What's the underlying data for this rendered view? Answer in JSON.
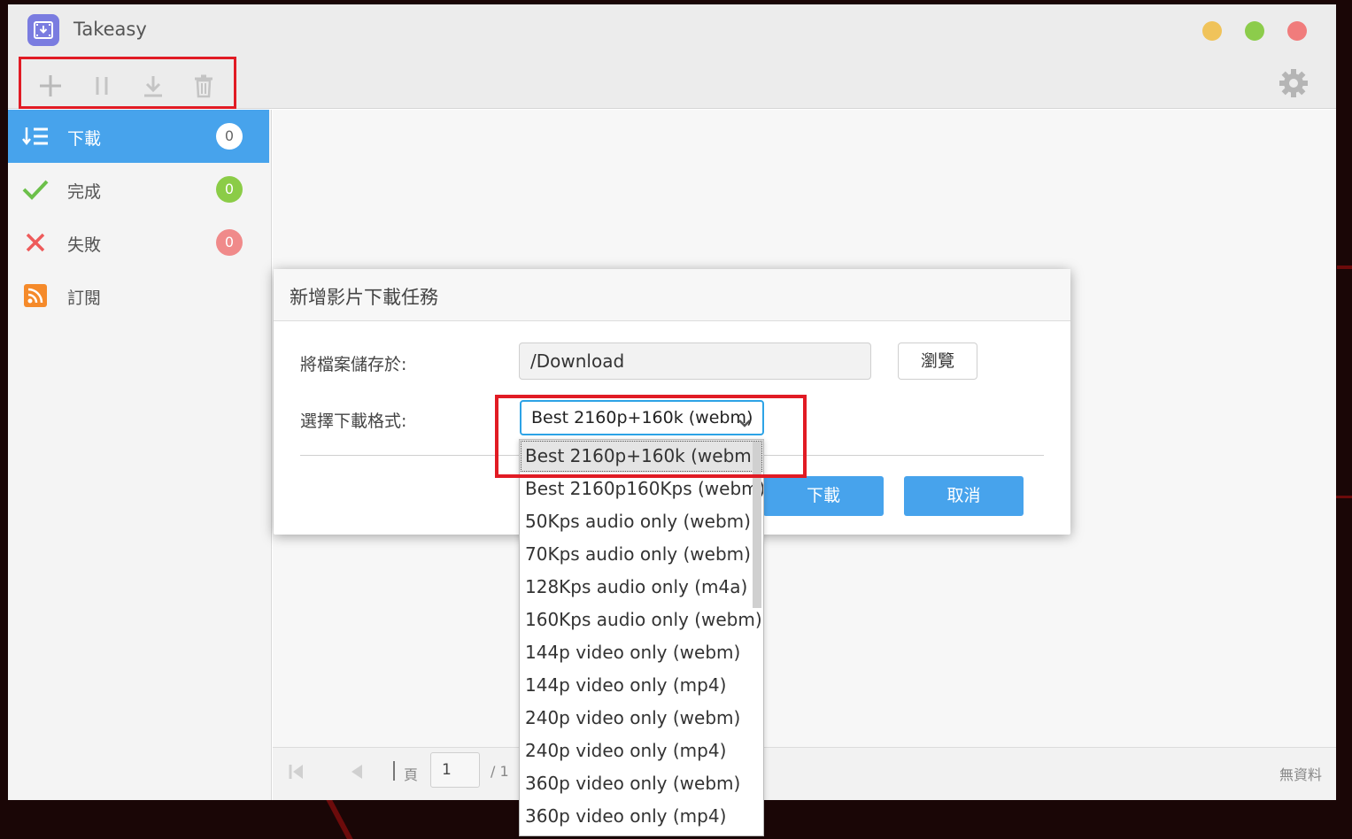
{
  "app": {
    "title": "Takeasy"
  },
  "toolbar": {
    "add_icon": "plus-icon",
    "pause_icon": "pause-icon",
    "download_icon": "download-icon",
    "delete_icon": "trash-icon",
    "settings_icon": "gear-icon"
  },
  "sidebar": {
    "items": [
      {
        "label": "下載",
        "count": "0",
        "icon": "download-list-icon"
      },
      {
        "label": "完成",
        "count": "0",
        "icon": "check-icon"
      },
      {
        "label": "失敗",
        "count": "0",
        "icon": "cross-icon"
      },
      {
        "label": "訂閱",
        "icon": "rss-icon"
      }
    ]
  },
  "footer": {
    "page_label": "頁",
    "page_value": "1",
    "page_total": "/ 1",
    "status": "無資料"
  },
  "dialog": {
    "title": "新增影片下載任務",
    "save_label": "將檔案儲存於:",
    "save_path": "/Download",
    "browse_label": "瀏覽",
    "format_label": "選擇下載格式:",
    "format_selected": "Best 2160p+160k (webm)",
    "ok_label": "下載",
    "cancel_label": "取消"
  },
  "format_options": [
    "Best 2160p+160k (webm)",
    "Best 2160p160Kps (webm)",
    "50Kps audio only (webm)",
    "70Kps audio only (webm)",
    "128Kps audio only (m4a)",
    "160Kps audio only (webm)",
    "144p video only (webm)",
    "144p video only (mp4)",
    "240p video only (webm)",
    "240p video only (mp4)",
    "360p video only (webm)",
    "360p video only (mp4)"
  ],
  "colors": {
    "accent": "#47a3ec",
    "highlight": "#e11b24",
    "success": "#8bcc47",
    "danger": "#f08a8a"
  }
}
